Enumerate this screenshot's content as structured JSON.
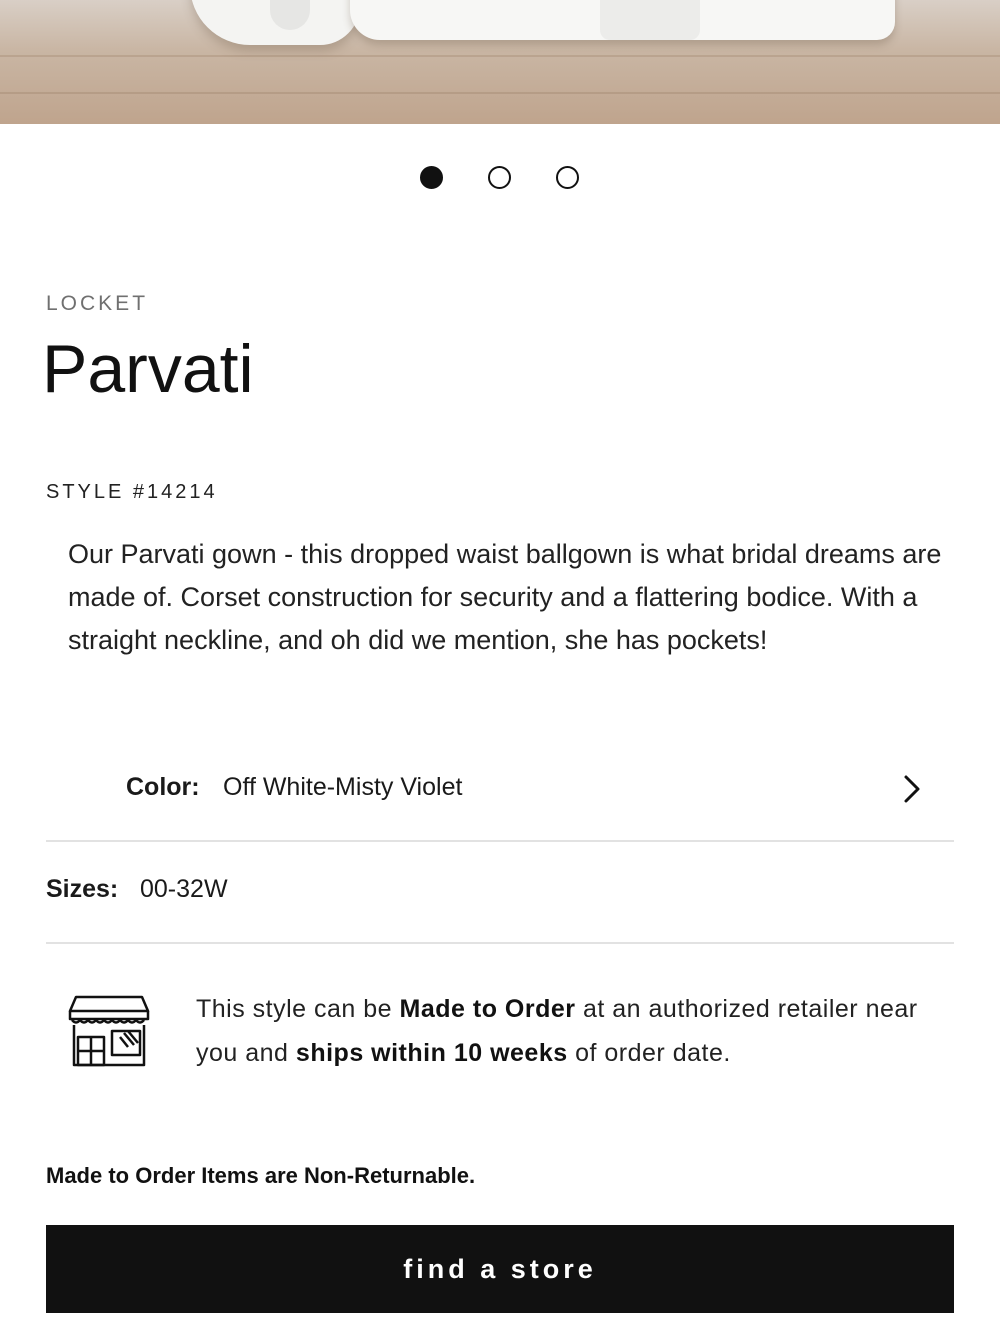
{
  "carousel": {
    "slide_count": 3,
    "active_index": 0
  },
  "product": {
    "brand": "LOCKET",
    "name": "Parvati",
    "style": "STYLE #14214",
    "description": "Our Parvati gown - this dropped waist ballgown is what bridal dreams are made of. Corset construction for security and a flattering bodice. With a straight neckline, and oh did we mention, she has pockets!"
  },
  "color": {
    "label": "Color:",
    "value": "Off White-Misty Violet",
    "icon": "chevron-right-icon"
  },
  "sizes": {
    "label": "Sizes:",
    "value": "00-32W"
  },
  "made_to_order": {
    "icon": "store-icon",
    "text_1": "This style can be ",
    "bold_1": "Made to Order",
    "text_2": " at an authorized retailer near you and ",
    "bold_2": "ships within 10 weeks",
    "text_3": " of order date."
  },
  "notice": "Made to Order Items are Non-Returnable.",
  "cta": {
    "label": "find a store"
  },
  "colors": {
    "button_bg": "#111111",
    "divider": "#e2e2e2"
  }
}
